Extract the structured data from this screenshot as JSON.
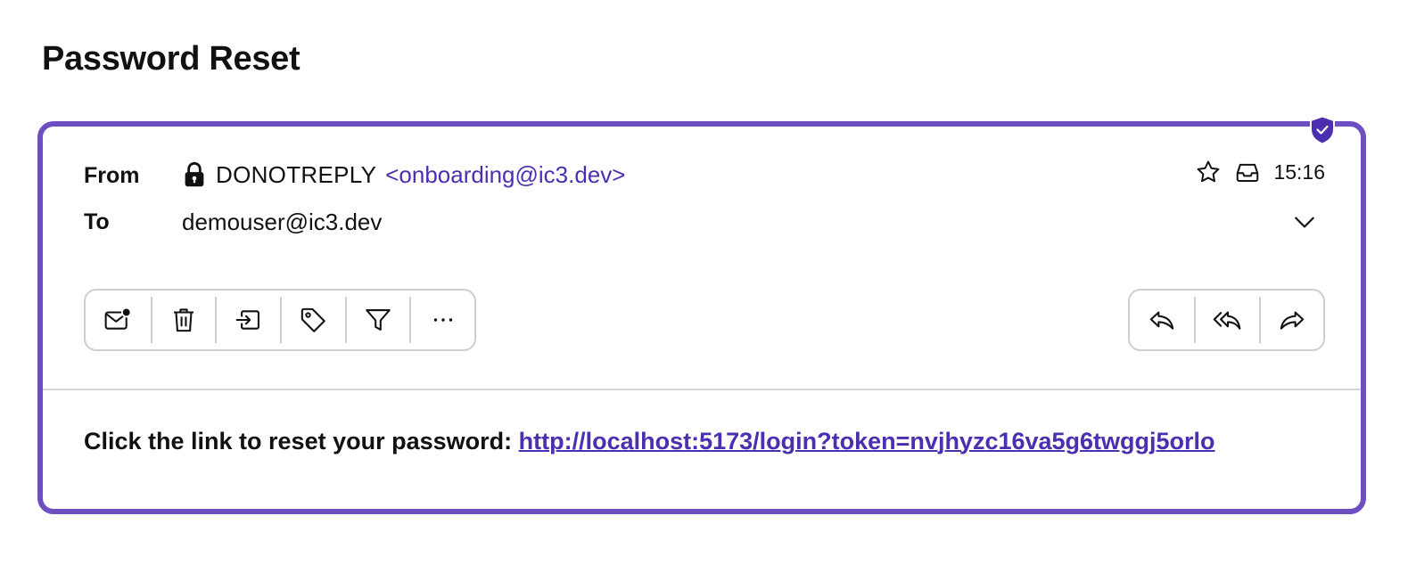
{
  "page": {
    "title": "Password Reset"
  },
  "email": {
    "from_label": "From",
    "to_label": "To",
    "sender_name": "DONOTREPLY",
    "sender_email": "<onboarding@ic3.dev>",
    "recipient": "demouser@ic3.dev",
    "time": "15:16",
    "body_prefix": "Click the link to reset your password:",
    "body_link": "http://localhost:5173/login?token=nvjhyzc16va5g6twggj5orlo"
  },
  "icons": {
    "verified": "shield-check-icon",
    "lock": "lock-icon",
    "star": "star-icon",
    "inbox": "inbox-icon",
    "expand": "chevron-down-icon",
    "toolbar_left": [
      "mark-unread-icon",
      "trash-icon",
      "move-icon",
      "tag-icon",
      "filter-icon",
      "more-icon"
    ],
    "toolbar_right": [
      "reply-icon",
      "reply-all-icon",
      "forward-icon"
    ]
  },
  "colors": {
    "accent": "#6d4fc2",
    "link": "#4b2fb0",
    "border": "#cfcfcf"
  }
}
